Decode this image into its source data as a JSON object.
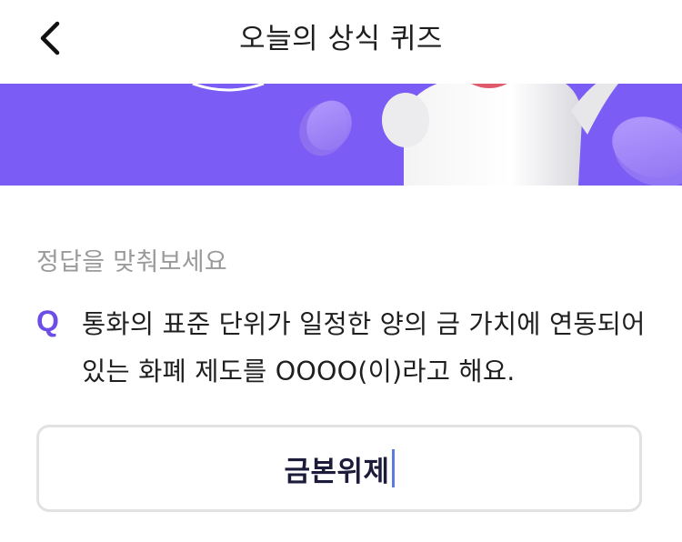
{
  "header": {
    "title": "오늘의 상식 퀴즈",
    "back_icon": "chevron-left-icon"
  },
  "banner": {
    "background_color": "#7b5cf5"
  },
  "quiz": {
    "prompt": "정답을 맞춰보세요",
    "q_label": "Q",
    "question": "통화의 표준 단위가 일정한 양의 금 가치에 연동되어 있는 화폐 제도를 OOOO(이)라고 해요.",
    "answer_value": "금본위제",
    "accent_color": "#6d4de8"
  }
}
